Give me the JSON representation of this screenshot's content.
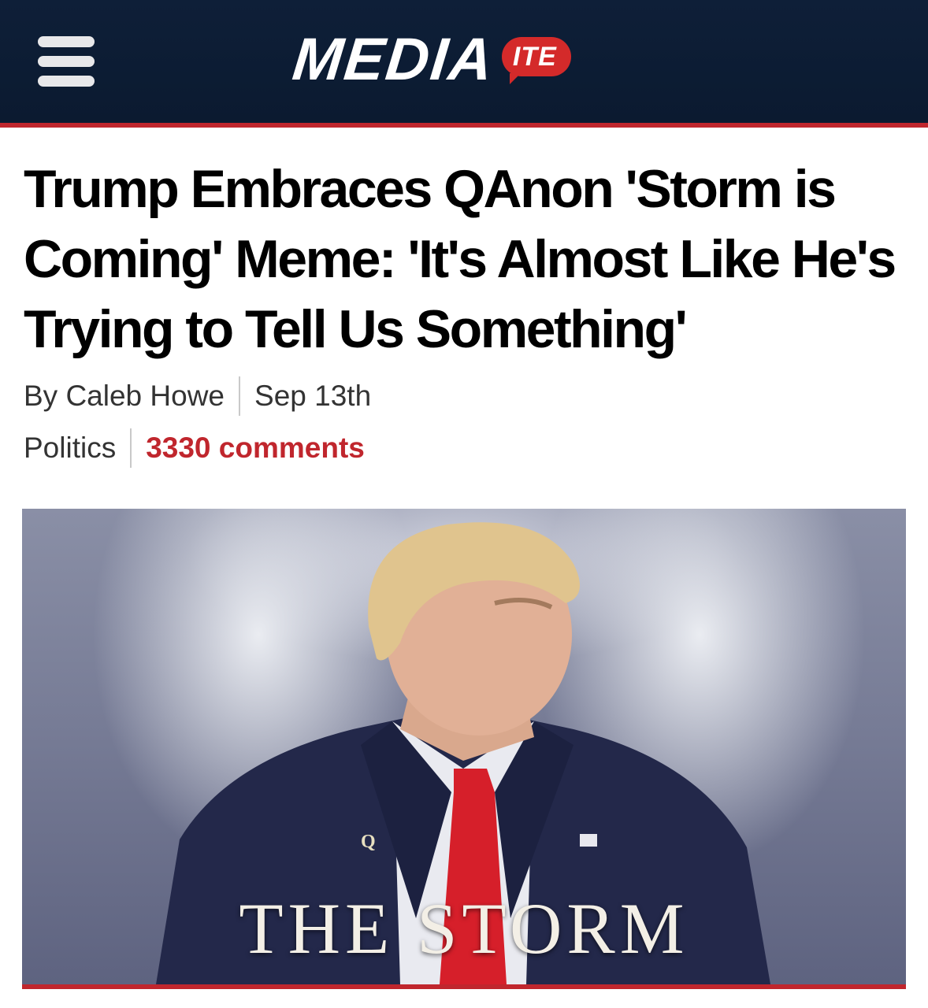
{
  "header": {
    "menu_icon": "hamburger-menu-icon",
    "logo_main": "MEDIA",
    "logo_badge": "ITE",
    "colors": {
      "bar": "#0e1f38",
      "accent": "#c0262d"
    }
  },
  "article": {
    "headline": "Trump Embraces QAnon 'Storm is Coming' Meme: 'It's Almost Like He's Trying to Tell Us Something'",
    "author": "By Caleb Howe",
    "date": "Sep 13th",
    "category": "Politics",
    "comments": "3330 comments"
  },
  "feature_image": {
    "lapel_pin": "Q",
    "caption_text": "THE STORM"
  }
}
